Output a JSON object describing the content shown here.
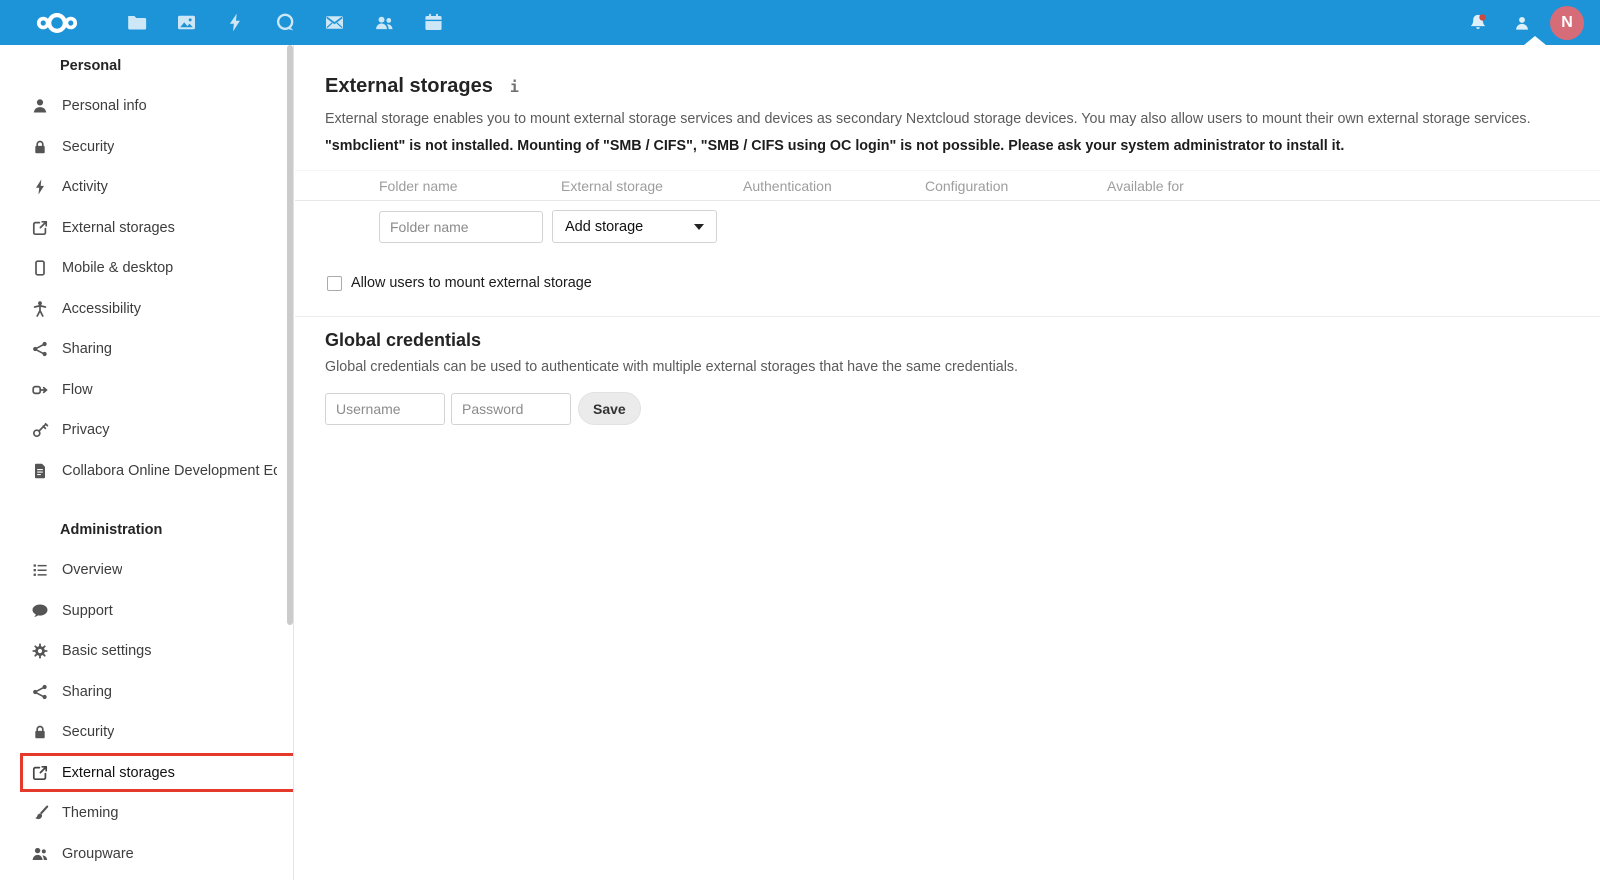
{
  "colors": {
    "header_bg": "#1d94d8",
    "avatar_bg": "#d66c77",
    "active_highlight": "#e4392b",
    "notification_dot": "#ea3d2a"
  },
  "header": {
    "app_icons": [
      "files-folder-icon",
      "photos-icon",
      "activity-icon",
      "talk-icon",
      "mail-icon",
      "contacts-icon",
      "calendar-icon"
    ],
    "avatar_initial": "N"
  },
  "sidebar": {
    "sections": [
      {
        "title": "Personal",
        "items": [
          {
            "label": "Personal info",
            "icon": "user-icon"
          },
          {
            "label": "Security",
            "icon": "lock-icon"
          },
          {
            "label": "Activity",
            "icon": "bolt-icon"
          },
          {
            "label": "External storages",
            "icon": "external-link-icon"
          },
          {
            "label": "Mobile & desktop",
            "icon": "phone-icon"
          },
          {
            "label": "Accessibility",
            "icon": "accessibility-icon"
          },
          {
            "label": "Sharing",
            "icon": "share-icon"
          },
          {
            "label": "Flow",
            "icon": "flow-icon"
          },
          {
            "label": "Privacy",
            "icon": "key-icon"
          },
          {
            "label": "Collabora Online Development Edit...",
            "icon": "document-icon"
          }
        ]
      },
      {
        "title": "Administration",
        "items": [
          {
            "label": "Overview",
            "icon": "list-icon"
          },
          {
            "label": "Support",
            "icon": "comment-icon"
          },
          {
            "label": "Basic settings",
            "icon": "gear-icon"
          },
          {
            "label": "Sharing",
            "icon": "share-icon"
          },
          {
            "label": "Security",
            "icon": "lock-icon"
          },
          {
            "label": "External storages",
            "icon": "external-link-icon",
            "active": true
          },
          {
            "label": "Theming",
            "icon": "brush-icon"
          },
          {
            "label": "Groupware",
            "icon": "group-icon"
          }
        ]
      }
    ]
  },
  "main": {
    "title": "External storages",
    "info_icon": "i",
    "description": "External storage enables you to mount external storage services and devices as secondary Nextcloud storage devices. You may also allow users to mount their own external storage services.",
    "warning": "\"smbclient\" is not installed. Mounting of \"SMB / CIFS\", \"SMB / CIFS using OC login\" is not possible. Please ask your system administrator to install it.",
    "table": {
      "headers": [
        "Folder name",
        "External storage",
        "Authentication",
        "Configuration",
        "Available for"
      ],
      "new_row": {
        "folder_placeholder": "Folder name",
        "storage_selected": "Add storage"
      }
    },
    "allow_users_label": "Allow users to mount external storage",
    "allow_users_checked": false,
    "global_credentials": {
      "title": "Global credentials",
      "description": "Global credentials can be used to authenticate with multiple external storages that have the same credentials.",
      "username_placeholder": "Username",
      "password_placeholder": "Password",
      "save_label": "Save"
    }
  }
}
